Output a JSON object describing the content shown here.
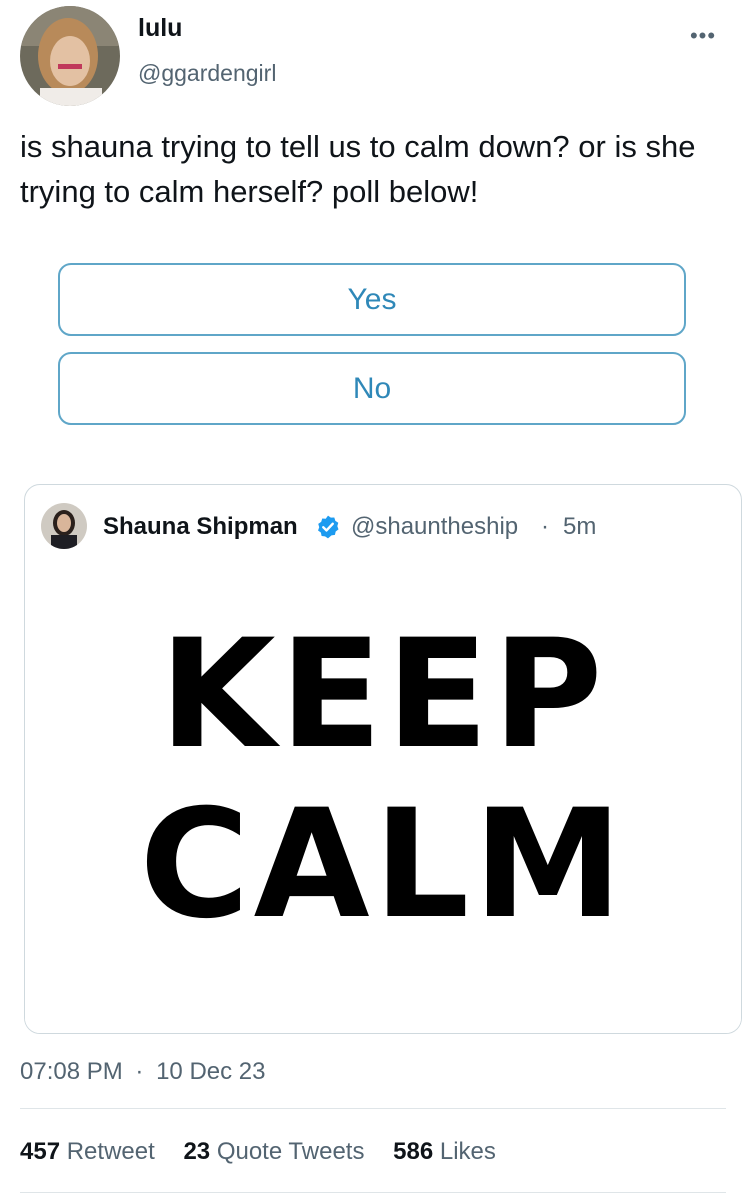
{
  "tweet": {
    "author": {
      "display_name": "lulu",
      "handle": "@ggardengirl"
    },
    "more_icon": "more-horizontal-icon",
    "text": "is shauna trying to tell us to calm down? or is she trying to calm herself? poll below!",
    "poll": {
      "options": [
        "Yes",
        "No"
      ]
    },
    "quoted": {
      "display_name": "Shauna Shipman",
      "verified_icon": "verified-badge-icon",
      "handle": "@shauntheship",
      "separator": "·",
      "time_ago": "5m",
      "media_text": [
        "KEEP",
        "CALM"
      ]
    },
    "timestamp": {
      "time": "07:08 PM",
      "separator": "·",
      "date": "10 Dec 23"
    },
    "stats": {
      "retweets": {
        "count": "457",
        "label": "Retweet"
      },
      "quotes": {
        "count": "23",
        "label": "Quote Tweets"
      },
      "likes": {
        "count": "586",
        "label": "Likes"
      }
    }
  },
  "colors": {
    "poll_border": "#5fa6c8",
    "poll_text": "#2f88b8",
    "verified": "#1d9bf0",
    "secondary_text": "#536471"
  }
}
